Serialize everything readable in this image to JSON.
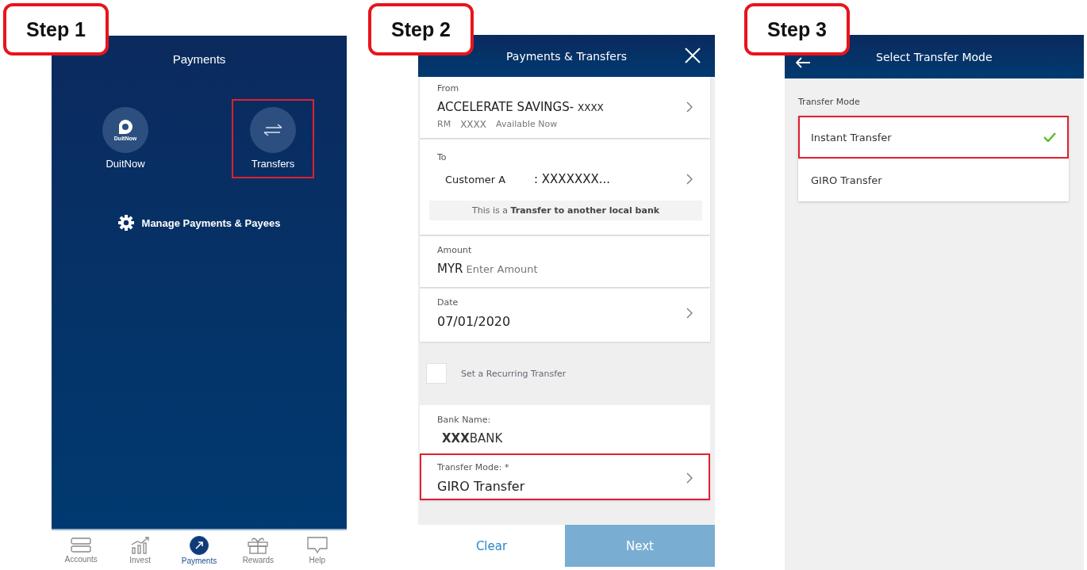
{
  "step_labels": [
    "Step 1",
    "Step 2",
    "Step 3"
  ],
  "payments_screen": {
    "title": "Payments",
    "tiles": [
      {
        "kind": "duitnow",
        "label": "DuitNow",
        "logo_text": "DuitNow",
        "highlighted": false
      },
      {
        "kind": "transfers",
        "label": "Transfers",
        "highlighted": true
      }
    ],
    "manage_link": "Manage Payments & Payees",
    "nav": [
      {
        "label": "Accounts",
        "selected": false
      },
      {
        "label": "Invest",
        "selected": false
      },
      {
        "label": "Payments",
        "selected": true
      },
      {
        "label": "Rewards",
        "selected": false
      },
      {
        "label": "Help",
        "selected": false
      }
    ]
  },
  "transfer_form_screen": {
    "title": "Payments & Transfers",
    "from": {
      "label": "From",
      "account": "ACCELERATE SAVINGS-",
      "account_suffix": "XXXX",
      "currency": "RM",
      "balance": "XXXX",
      "balance_note": "Available Now"
    },
    "to": {
      "label": "To",
      "name": "Customer A",
      "account": ": XXXXXXX...",
      "note": "This is a **Transfer to another local bank**"
    },
    "amount": {
      "label": "Amount",
      "currency": "MYR",
      "placeholder": "Enter Amount"
    },
    "date": {
      "label": "Date",
      "value": "07/01/2020"
    },
    "recurring": {
      "label": "Set a Recurring Transfer",
      "checked": false
    },
    "bank": {
      "label": "Bank Name:",
      "value": "**XXX**BANK"
    },
    "transfer_mode": {
      "label": "Transfer Mode: *",
      "value": "GIRO Transfer",
      "highlighted": true
    },
    "buttons": [
      {
        "label": "Clear",
        "disabled": false
      },
      {
        "label": "Next",
        "disabled": true
      }
    ]
  },
  "transfer_mode_screen": {
    "title": "Select Transfer Mode",
    "section_label": "Transfer Mode",
    "options": [
      {
        "label": "Instant Transfer",
        "selected": true,
        "highlighted": true
      },
      {
        "label": "GIRO Transfer",
        "selected": false,
        "highlighted": false
      }
    ]
  }
}
